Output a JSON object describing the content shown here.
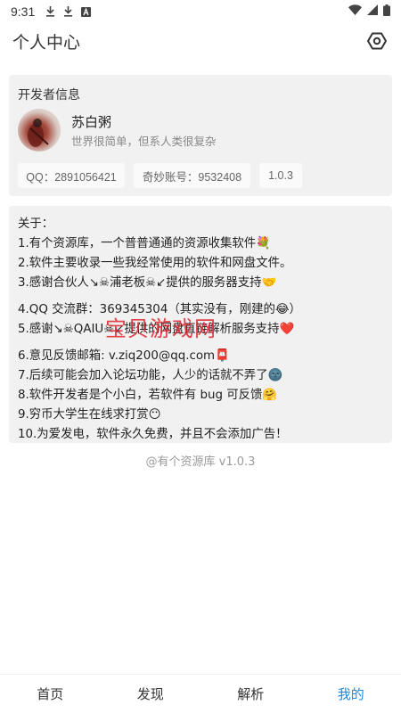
{
  "status_bar": {
    "time": "9:31",
    "icons": [
      "download-icon",
      "download-icon",
      "app-icon",
      "wifi-icon",
      "signal-icon",
      "battery-icon"
    ]
  },
  "header": {
    "title": "个人中心",
    "settings_icon": "settings-hexagon-icon"
  },
  "developer": {
    "section_title": "开发者信息",
    "name": "苏白粥",
    "motto": "世界很简单，但系人类很复杂",
    "chips": [
      "QQ：2891056421",
      "奇妙账号：9532408",
      "1.0.3"
    ]
  },
  "about": {
    "lines": [
      "关于：",
      "1.有个资源库，一个普普通通的资源收集软件💐",
      "2.软件主要收录一些我经常使用的软件和网盘文件。",
      "3.感谢合伙人↘☠浦老板☠↙提供的服务器支持🤝",
      "4.QQ 交流群：369345304（其实没有，刚建的😂）",
      "5.感谢↘☠QAIU☠↙提供的网盘直链解析服务支持❤️",
      "6.意见反馈邮箱: v.ziq200@qq.com📮",
      "7.后续可能会加入论坛功能，人少的话就不弄了🌚",
      "8.软件开发者是个小白，若软件有 bug 可反馈🤗",
      "9.穷币大学生在线求打赏😶",
      "10.为爱发电，软件永久免费，并且不会添加广告！"
    ]
  },
  "watermark": "宝贝游戏网",
  "footer": {
    "version": "@有个资源库 v1.0.3"
  },
  "bottom_nav": {
    "items": [
      "首页",
      "发现",
      "解析",
      "我的"
    ],
    "active_index": 3
  },
  "colors": {
    "accent": "#1e88e5",
    "card_bg": "#f1f1f1",
    "watermark": "#e0242f"
  }
}
